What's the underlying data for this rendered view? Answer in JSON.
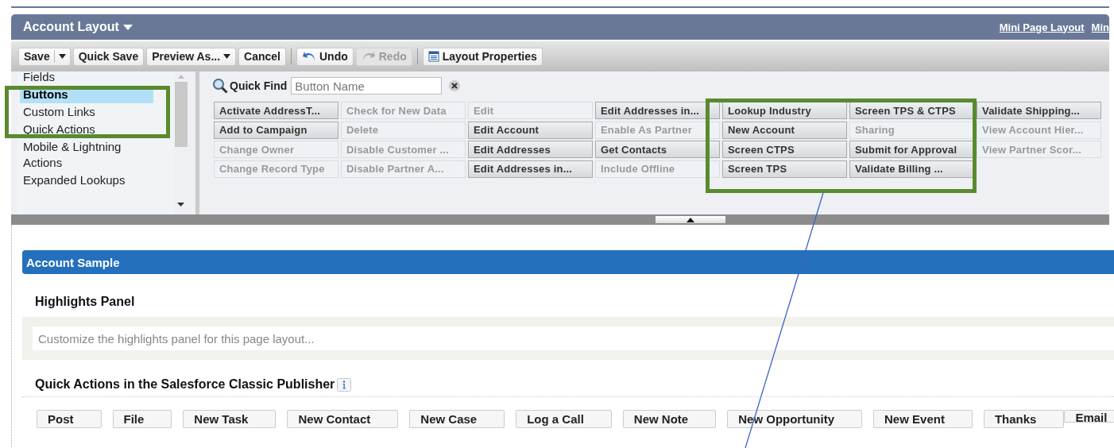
{
  "window": {
    "title": "Account Layout",
    "links": [
      "Mini Page Layout",
      "Min"
    ]
  },
  "toolbar": [
    {
      "kind": "split",
      "label": "Save",
      "disabled": false
    },
    {
      "kind": "plain",
      "label": "Quick Save",
      "disabled": false
    },
    {
      "kind": "menu",
      "label": "Preview As...",
      "disabled": false
    },
    {
      "kind": "plain",
      "label": "Cancel",
      "disabled": false
    },
    {
      "kind": "separator"
    },
    {
      "kind": "undo",
      "label": "Undo",
      "disabled": false
    },
    {
      "kind": "redo",
      "label": "Redo",
      "disabled": true
    },
    {
      "kind": "separator"
    },
    {
      "kind": "properties",
      "label": "Layout Properties",
      "disabled": false
    }
  ],
  "palette": {
    "categories": [
      {
        "label": "Fields",
        "selected": false
      },
      {
        "label": "Buttons",
        "selected": true
      },
      {
        "label": "Custom Links",
        "selected": false
      },
      {
        "label": "Quick Actions",
        "selected": false
      },
      {
        "label": "Mobile & Lightning Actions",
        "selected": false
      },
      {
        "label": "Expanded Lookups",
        "selected": false
      }
    ],
    "quick_find": {
      "label": "Quick Find",
      "placeholder": "Button Name"
    },
    "buttons": [
      {
        "label": "Activate AddressT...",
        "in_use": false
      },
      {
        "label": "Add to Campaign",
        "in_use": false
      },
      {
        "label": "Change Owner",
        "in_use": true
      },
      {
        "label": "Change Record Type",
        "in_use": true
      },
      {
        "label": "Check for New Data",
        "in_use": true
      },
      {
        "label": "Delete",
        "in_use": true
      },
      {
        "label": "Disable Customer ...",
        "in_use": true
      },
      {
        "label": "Disable Partner A...",
        "in_use": true
      },
      {
        "label": "Edit",
        "in_use": true
      },
      {
        "label": "Edit Account",
        "in_use": false
      },
      {
        "label": "Edit Addresses",
        "in_use": false
      },
      {
        "label": "Edit Addresses in...",
        "in_use": false
      },
      {
        "label": "Edit Addresses in...",
        "in_use": false
      },
      {
        "label": "Enable As Partner",
        "in_use": true
      },
      {
        "label": "Get Contacts",
        "in_use": false
      },
      {
        "label": "Include Offline",
        "in_use": true
      },
      {
        "label": "Lookup Industry",
        "in_use": false
      },
      {
        "label": "New Account",
        "in_use": false
      },
      {
        "label": "Screen CTPS",
        "in_use": false
      },
      {
        "label": "Screen TPS",
        "in_use": false
      },
      {
        "label": "Screen TPS & CTPS",
        "in_use": false
      },
      {
        "label": "Sharing",
        "in_use": true
      },
      {
        "label": "Submit for Approval",
        "in_use": false
      },
      {
        "label": "Validate Billing ...",
        "in_use": false
      },
      {
        "label": "Validate Shipping...",
        "in_use": false
      },
      {
        "label": "View Account Hier...",
        "in_use": true
      },
      {
        "label": "View Partner Scor...",
        "in_use": true
      }
    ]
  },
  "layout": {
    "section_title": "Account Sample",
    "highlights_title": "Highlights Panel",
    "highlights_hint": "Customize the highlights panel for this page layout...",
    "publisher_title": "Quick Actions in the Salesforce Classic Publisher",
    "quick_actions": [
      "Post",
      "File",
      "New Task",
      "New Contact",
      "New Case",
      "Log a Call",
      "New Note",
      "New Opportunity",
      "New Event",
      "Thanks",
      "Email"
    ]
  }
}
